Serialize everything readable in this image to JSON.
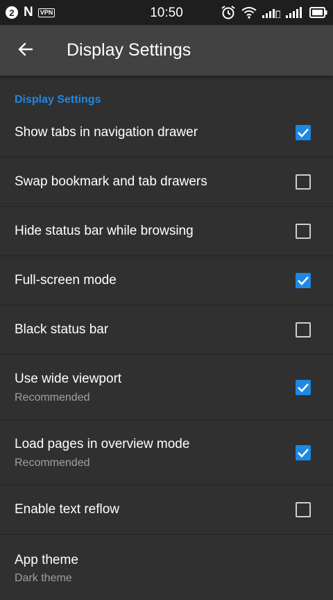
{
  "status_bar": {
    "notification_count": "2",
    "n_logo": "N",
    "vpn": "VPN",
    "time": "10:50"
  },
  "toolbar": {
    "title": "Display Settings"
  },
  "settings": {
    "category": "Display Settings",
    "items": [
      {
        "title": "Show tabs in navigation drawer",
        "checked": true
      },
      {
        "title": "Swap bookmark and tab drawers",
        "checked": false
      },
      {
        "title": "Hide status bar while browsing",
        "checked": false
      },
      {
        "title": "Full-screen mode",
        "checked": true
      },
      {
        "title": "Black status bar",
        "checked": false
      },
      {
        "title": "Use wide viewport",
        "summary": "Recommended",
        "checked": true
      },
      {
        "title": "Load pages in overview mode",
        "summary": "Recommended",
        "checked": true
      },
      {
        "title": "Enable text reflow",
        "checked": false
      },
      {
        "title": "App theme",
        "summary": "Dark theme"
      }
    ]
  },
  "colors": {
    "accent": "#1e88e5",
    "background": "#303030",
    "toolbar": "#424242",
    "status_bar": "#1e1e1e"
  }
}
